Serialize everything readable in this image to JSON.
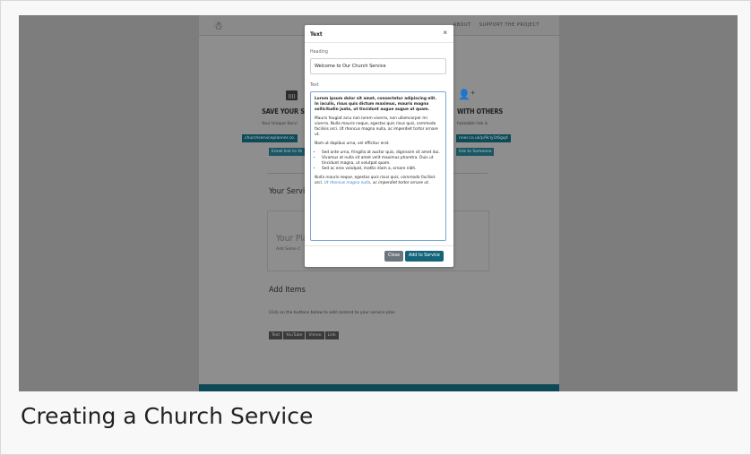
{
  "page": {
    "logo_glyph": "☃",
    "nav": [
      "ABOUT",
      "SUPPORT THE PROJECT"
    ],
    "save": {
      "title": "SAVE YOUR SE",
      "subtitle": "Your Unique Servi",
      "url": "churchserviceplanner.co.",
      "email_btn": "Email link to Yo"
    },
    "share": {
      "title": "WITH OTHERS",
      "subtitle": "hareable link is",
      "url": "nner.co.uk/p/9cly1t6gqd",
      "email_btn": "link to Someone"
    },
    "service_title": "Your Servic",
    "plan_title": "Your Pla",
    "plan_sub": "Add Some C",
    "add_items": "Add Items",
    "add_items_sub": "Click on the buttons below to add content to your service plan",
    "item_buttons": [
      "Text",
      "YouTube",
      "Vimeo",
      "Link"
    ]
  },
  "modal": {
    "title": "Text",
    "close_glyph": "×",
    "heading_label": "Heading",
    "heading_value": "Welcome to Our Church Service",
    "text_label": "Text",
    "text": {
      "p1": "Lorem ipsum dolor sit amet, consectetur adipiscing elit. In iaculis, risus quis dictum maximus, mauris magna sollicitudin justo, ut tincidunt augue augue ut quam.",
      "p2": "Mauris feugiat arcu non lorem viverra, non ullamcorper mi viverra. Nulla mauris neque, egestas quis risus quis, commodo facilisis orci. Ut rhoncus magna nulla, ac imperdiet tortor ornare ut.",
      "p3": "Nam ut dapibus urna, vel efficitur erat.",
      "list": [
        "Sed ante urna, fringilla at auctor quis, dignissim sit amet dui.",
        "Vivamus at nulla sit amet velit maximus pharetra. Duis ut tincidunt magna, ut volutpat quam.",
        "Sed ac eros volutpat, mattis diam a, ornare nibh."
      ],
      "p4_a": "Nulla mauris neque, egestas quis risus quis, commodo facilisis orci. ",
      "p4_link": "Ut rhoncus magna nulla",
      "p4_b": ", ac imperdiet tortor ornare ut."
    },
    "close_label": "Close",
    "add_label": "Add to Service"
  },
  "caption": "Creating a Church Service"
}
